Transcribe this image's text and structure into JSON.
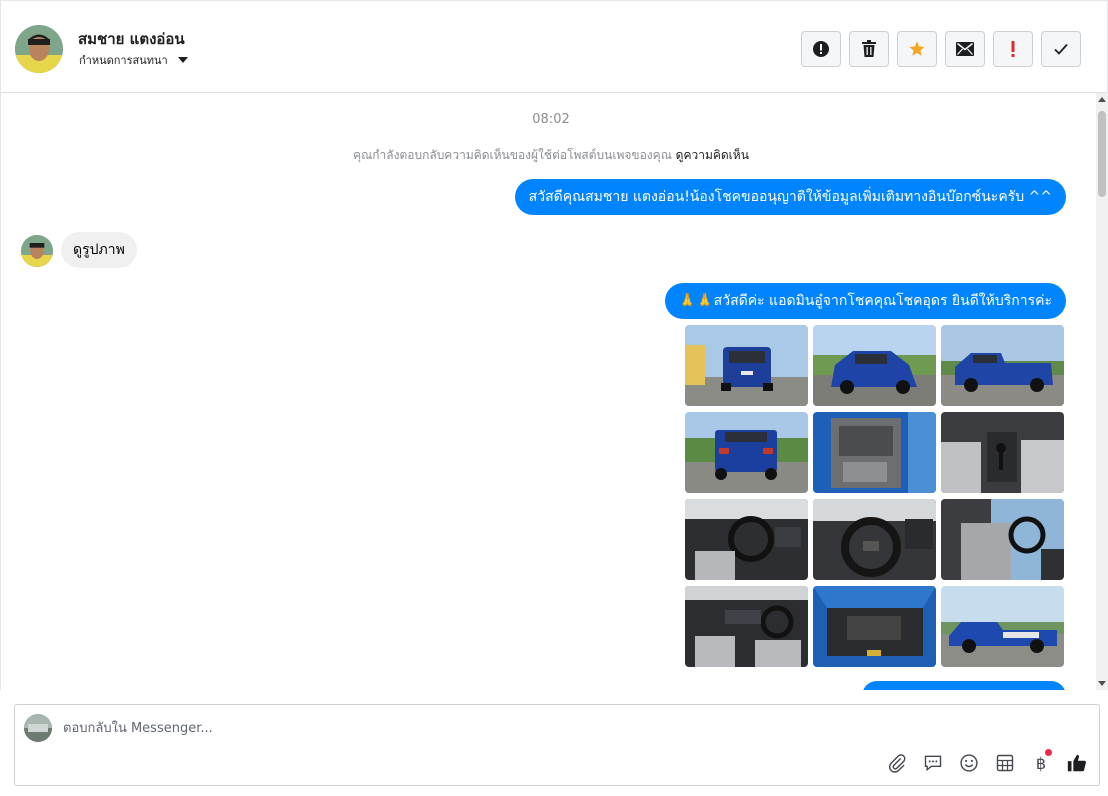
{
  "header": {
    "contact_name": "สมชาย แตงอ่อน",
    "assign_label": "กำหนดการสนทนา",
    "actions": [
      {
        "icon": "alert-circle-icon"
      },
      {
        "icon": "trash-icon"
      },
      {
        "icon": "star-icon",
        "color": "#f5a623"
      },
      {
        "icon": "envelope-icon"
      },
      {
        "icon": "exclamation-icon",
        "color": "#e02a2a"
      },
      {
        "icon": "check-icon"
      }
    ]
  },
  "conversation": {
    "timestamp": "08:02",
    "notice_text": "คุณกำลังตอบกลับความคิดเห็นของผู้ใช้ต่อโพสต์บนเพจของคุณ",
    "notice_link": "ดูความคิดเห็น",
    "messages": [
      {
        "direction": "outgoing",
        "text": "สวัสดีคุณสมชาย แตงอ่อน!น้องโชคขออนุญาติให้ข้อมูลเพิ่มเติมทางอินบ๊อกซ์นะครับ ^^"
      },
      {
        "direction": "incoming",
        "text": "ดูรูปภาพ"
      },
      {
        "direction": "outgoing",
        "text": "🙏🙏สวัสดีค่ะ แอดมินอู๋จากโชคคุณโชคอุดร ยินดีให้บริการค่ะ"
      }
    ],
    "photos_count": 12
  },
  "composer": {
    "placeholder": "ตอบกลับใน Messenger...",
    "tools": [
      "paperclip-icon",
      "chat-bubble-icon",
      "emoji-icon",
      "table-icon",
      "baht-icon",
      "thumbs-up-icon"
    ],
    "baht_symbol": "฿",
    "accent_color": "#0084ff"
  }
}
